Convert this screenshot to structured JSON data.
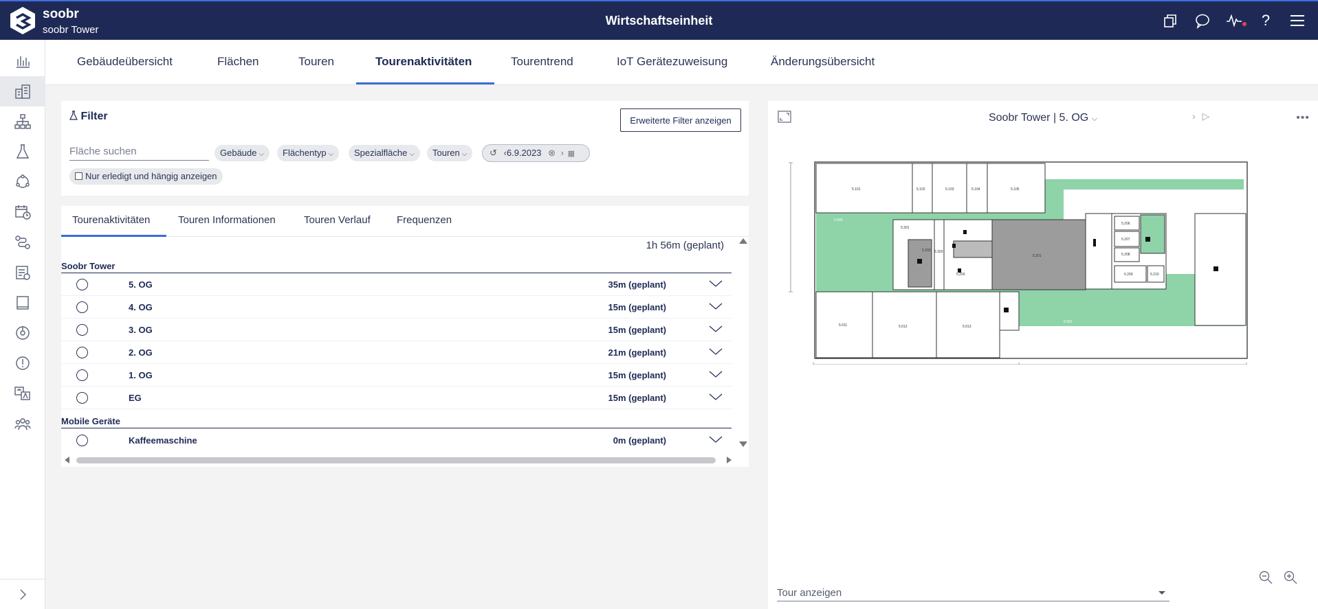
{
  "app": {
    "brand_name": "soobr",
    "brand_sub": "soobr Tower",
    "page_title": "Wirtschaftseinheit"
  },
  "top_icons": [
    "copy-icon",
    "chat-icon",
    "activity-icon",
    "help-icon",
    "menu-icon"
  ],
  "rail_icons": [
    "bar-chart-icon",
    "building-icon",
    "hierarchy-icon",
    "flask-icon",
    "cycle-icon",
    "calendar-clock-icon",
    "routing-icon",
    "checklist-icon",
    "tablet-icon",
    "target-icon",
    "alert-icon",
    "translate-icon",
    "team-icon"
  ],
  "tabs": [
    {
      "label": "Gebäudeübersicht"
    },
    {
      "label": "Flächen"
    },
    {
      "label": "Touren"
    },
    {
      "label": "Tourenaktivitäten"
    },
    {
      "label": "Tourentrend"
    },
    {
      "label": "IoT Gerätezuweisung"
    },
    {
      "label": "Änderungsübersicht"
    }
  ],
  "active_tab": "Tourenaktivitäten",
  "filter": {
    "title": "Filter",
    "advanced_button": "Erweiterte Filter anzeigen",
    "search_placeholder": "Fläche suchen",
    "chips": [
      "Gebäude",
      "Flächentyp",
      "Spezialfläche",
      "Touren"
    ],
    "date": "6.9.2023",
    "checkbox_label": "Nur erledigt und hängig anzeigen"
  },
  "inner_tabs": [
    {
      "label": "Tourenaktivitäten"
    },
    {
      "label": "Touren Informationen"
    },
    {
      "label": "Touren Verlauf"
    },
    {
      "label": "Frequenzen"
    }
  ],
  "summary": "1h 56m (geplant)",
  "groups": [
    {
      "name": "Soobr Tower",
      "rows": [
        {
          "name": "5. OG",
          "time": "35m (geplant)"
        },
        {
          "name": "4. OG",
          "time": "15m (geplant)"
        },
        {
          "name": "3. OG",
          "time": "15m (geplant)"
        },
        {
          "name": "2. OG",
          "time": "21m (geplant)"
        },
        {
          "name": "1. OG",
          "time": "15m (geplant)"
        },
        {
          "name": "EG",
          "time": "15m (geplant)"
        }
      ]
    },
    {
      "name": "Mobile Geräte",
      "rows": [
        {
          "name": "Kaffeemaschine",
          "time": "0m (geplant)"
        }
      ]
    }
  ],
  "map": {
    "title": "Soobr Tower | 5. OG",
    "tour_select_placeholder": "Tour anzeigen",
    "room_labels": [
      "5.101",
      "5.102",
      "5.103",
      "5.104",
      "5.105",
      "5.201",
      "5.203",
      "5.206",
      "5.207",
      "5.208",
      "5.209",
      "5.210",
      "5.011",
      "5.012",
      "5.013",
      "5.301",
      "5.303",
      "5.200",
      "5.005",
      "5.001"
    ]
  },
  "colors": {
    "topbar": "#1e2a55",
    "accent": "#3a6bd9",
    "map_green": "#8fd3a8",
    "map_gray": "#9c9c9c"
  }
}
